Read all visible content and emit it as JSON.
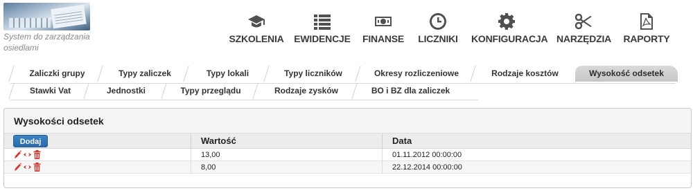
{
  "header": {
    "logo_text": "System do zarządzania osiedlami",
    "nav": [
      {
        "label": "SZKOLENIA",
        "icon": "graduation-cap-icon"
      },
      {
        "label": "EWIDENCJE",
        "icon": "list-icon"
      },
      {
        "label": "FINANSE",
        "icon": "money-icon"
      },
      {
        "label": "LICZNIKI",
        "icon": "clock-icon"
      },
      {
        "label": "KONFIGURACJA",
        "icon": "gear-icon"
      },
      {
        "label": "NARZĘDZIA",
        "icon": "scissors-icon"
      },
      {
        "label": "RAPORTY",
        "icon": "pdf-icon"
      }
    ]
  },
  "tabs": {
    "row1": [
      {
        "label": "Zaliczki grupy"
      },
      {
        "label": "Typy zaliczek"
      },
      {
        "label": "Typy lokali"
      },
      {
        "label": "Typy liczników"
      },
      {
        "label": "Okresy rozliczeniowe"
      },
      {
        "label": "Rodzaje kosztów"
      },
      {
        "label": "Wysokość odsetek",
        "active": true
      }
    ],
    "row2": [
      {
        "label": "Stawki Vat"
      },
      {
        "label": "Jednostki"
      },
      {
        "label": "Typy przeglądu"
      },
      {
        "label": "Rodzaje zysków"
      },
      {
        "label": "BO i BZ dla zaliczek"
      }
    ]
  },
  "panel": {
    "title": "Wysokości odsetek",
    "add_button": "Dodaj",
    "columns": [
      "Wartość",
      "Data"
    ],
    "rows": [
      {
        "value": "13,00",
        "date": "01.11.2012 00:00:00"
      },
      {
        "value": "8,00",
        "date": "22.12.2014 00:00:00"
      }
    ],
    "action_icons": [
      "pencil-icon",
      "eye-icon",
      "trash-icon"
    ]
  },
  "colors": {
    "accent_button": "#2f72b3",
    "action_icon": "#d23a2f",
    "active_tab": "#cccccc"
  }
}
